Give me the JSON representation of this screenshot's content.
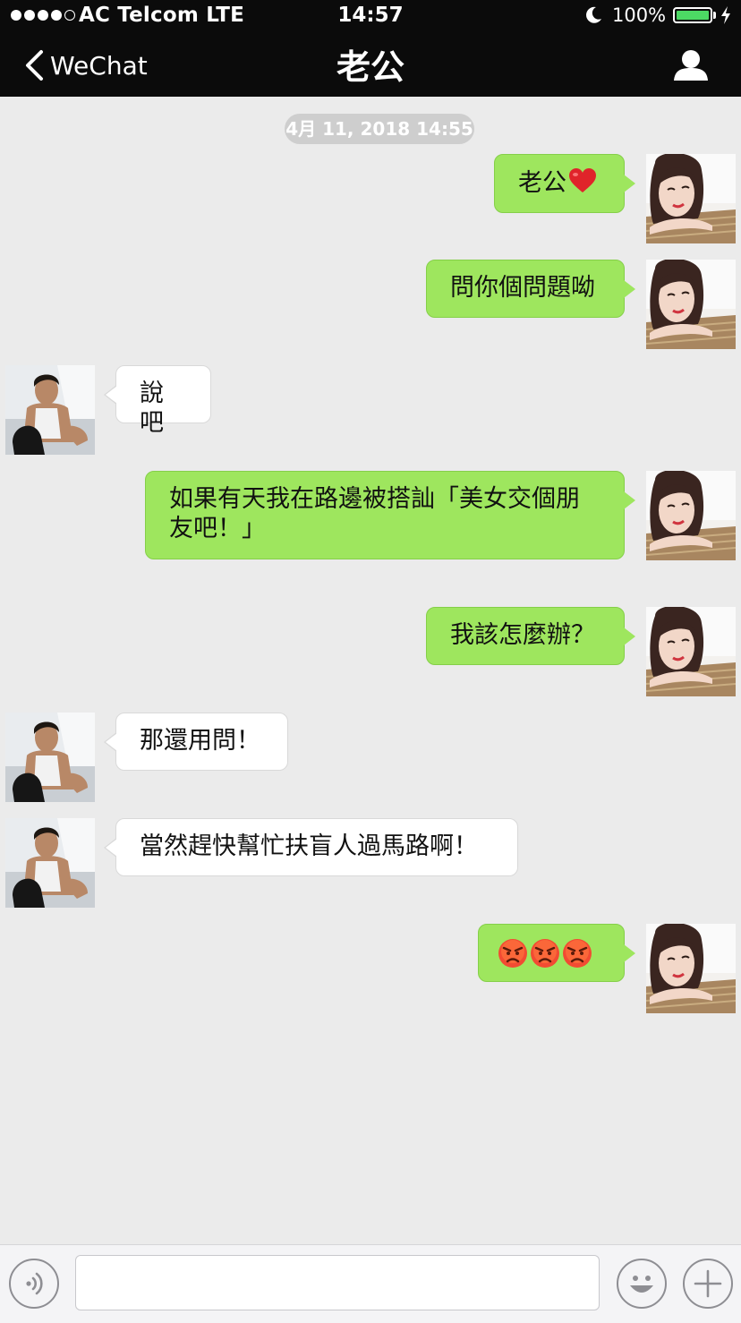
{
  "status_bar": {
    "signal_dots": "●●●●○",
    "carrier": "AC Telcom LTE",
    "time": "14:57",
    "battery": "100%",
    "battery_level": 1.0
  },
  "nav": {
    "back_label": "WeChat",
    "title": "老公",
    "back_icon": "chevron-left-icon",
    "profile_icon": "person-icon"
  },
  "chat": {
    "timestamp": "4月 11, 2018 14:55",
    "messages": [
      {
        "sender": "me",
        "text": "老公"
      },
      {
        "sender": "me",
        "text": "問你個問題呦"
      },
      {
        "sender": "other",
        "text": "說吧"
      },
      {
        "sender": "me",
        "text": "如果有天我在路邊被搭訕「美女交個朋友吧！」"
      },
      {
        "sender": "me",
        "text": "我該怎麼辦？"
      },
      {
        "sender": "other",
        "text": "那還用問！"
      },
      {
        "sender": "other",
        "text": "當然趕快幫忙扶盲人過馬路啊！"
      },
      {
        "sender": "me",
        "text": ""
      }
    ],
    "emoji": {
      "heart": "heart-emoji",
      "angry": "angry-face-emoji"
    }
  },
  "input_bar": {
    "voice_icon": "voice-icon",
    "input_value": "",
    "emoji_icon": "smiley-icon",
    "plus_icon": "plus-icon"
  },
  "colors": {
    "nav_bg": "#0b0b0b",
    "chat_bg": "#ebebeb",
    "my_bubble": "#9ee65e",
    "their_bubble": "#ffffff",
    "battery": "#4cd964"
  }
}
